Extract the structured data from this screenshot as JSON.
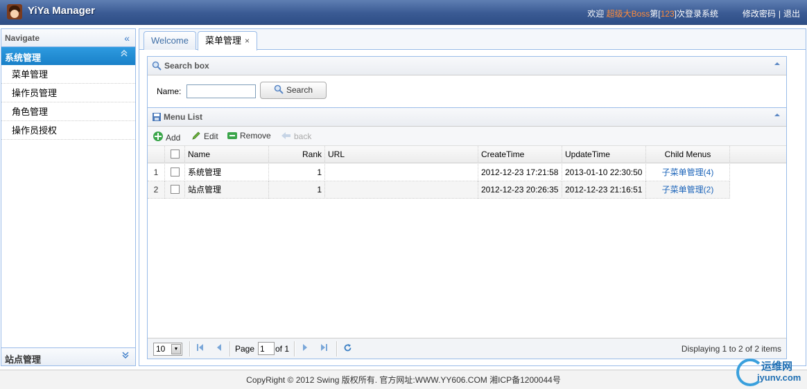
{
  "header": {
    "app_title": "YiYa Manager",
    "welcome_prefix": "欢迎",
    "user_name": "超级大Boss",
    "login_prefix": "第[",
    "login_count": "123",
    "login_suffix": "]次登录系统",
    "change_password": "修改密码",
    "separator": "|",
    "logout": "退出"
  },
  "nav": {
    "title": "Navigate",
    "collapse_icon": "«",
    "groups": [
      {
        "label": "系统管理",
        "items": [
          "菜单管理",
          "操作员管理",
          "角色管理",
          "操作员授权"
        ]
      },
      {
        "label": "站点管理"
      }
    ]
  },
  "tabs": [
    {
      "label": "Welcome"
    },
    {
      "label": "菜单管理",
      "close": "×"
    }
  ],
  "search": {
    "title": "Search box",
    "name_label": "Name:",
    "name_value": "",
    "button_label": "Search"
  },
  "menu_list": {
    "title": "Menu List",
    "toolbar": {
      "add": "Add",
      "edit": "Edit",
      "remove": "Remove",
      "back": "back"
    },
    "columns": [
      "Name",
      "Rank",
      "URL",
      "CreateTime",
      "UpdateTime",
      "Child Menus"
    ],
    "rows": [
      {
        "num": "1",
        "name": "系统管理",
        "rank": "1",
        "url": "",
        "create_time": "2012-12-23 17:21:58",
        "update_time": "2013-01-10 22:30:50",
        "child": "子菜单管理(4)"
      },
      {
        "num": "2",
        "name": "站点管理",
        "rank": "1",
        "url": "",
        "create_time": "2012-12-23 20:26:35",
        "update_time": "2012-12-23 21:16:51",
        "child": "子菜单管理(2)"
      }
    ]
  },
  "pager": {
    "page_size": "10",
    "page_label": "Page",
    "page_value": "1",
    "of_label": "of 1",
    "display": "Displaying 1 to 2 of 2 items"
  },
  "footer": {
    "text": "CopyRight © 2012 Swing 版权所有.   官方网址:WWW.YY606.COM    湘ICP备1200044号"
  },
  "watermark": {
    "line1": "运维网",
    "line2": "iyunv.com"
  },
  "colors": {
    "header": "#3a5a93",
    "nav_active": "#1e8cd7",
    "highlight": "#ff8c3a",
    "link": "#1a63b9"
  }
}
